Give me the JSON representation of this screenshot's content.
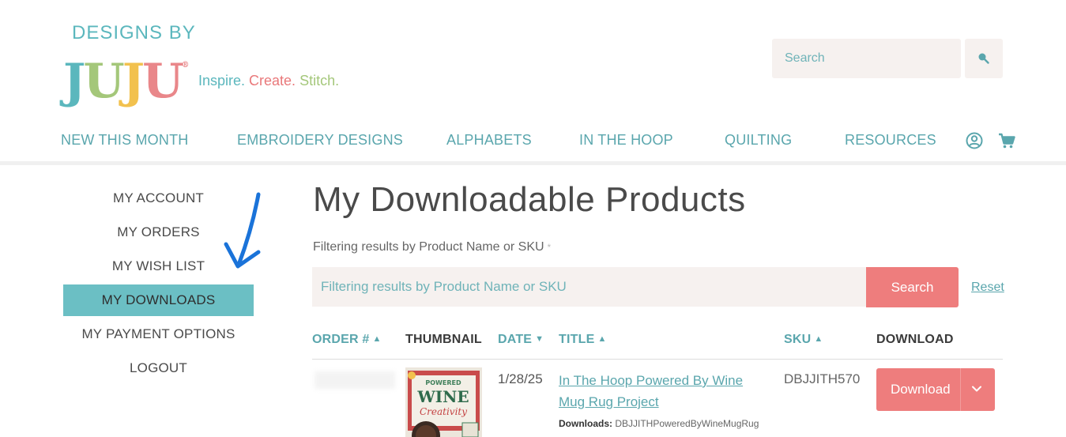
{
  "brand": {
    "logo_top": "DESIGNS BY",
    "logo_letters": [
      "J",
      "U",
      "J",
      "U"
    ],
    "logo_colors": [
      "#5bb7bd",
      "#a4c77a",
      "#f2c14e",
      "#e9878a"
    ],
    "registered": "®",
    "tagline_parts": [
      "Inspire.",
      " Create.",
      " Stitch."
    ],
    "tagline_colors": [
      "#5bb7bd",
      "#e9787a",
      "#a4c77a"
    ]
  },
  "header": {
    "search_placeholder": "Search",
    "search_icon": "search-icon"
  },
  "nav": {
    "items": [
      "NEW THIS MONTH",
      "EMBROIDERY DESIGNS",
      "ALPHABETS",
      "IN THE HOOP",
      "QUILTING",
      "RESOURCES"
    ],
    "account_icon": "user-circle-icon",
    "cart_icon": "cart-icon"
  },
  "sidebar": {
    "items": [
      "MY ACCOUNT",
      "MY ORDERS",
      "MY WISH LIST",
      "MY DOWNLOADS",
      "MY PAYMENT OPTIONS",
      "LOGOUT"
    ],
    "active_index": 3,
    "active_color": "#6bbfc4"
  },
  "annotation": {
    "arrow_icon": "blue-arrow-pointer",
    "arrow_color": "#1a73d9"
  },
  "main": {
    "title": "My Downloadable Products",
    "filter_label": "Filtering results by Product Name or SKU",
    "filter_required_mark": "*",
    "filter_placeholder": "Filtering results by Product Name or SKU",
    "search_button": "Search",
    "reset_link": "Reset",
    "accent_color": "#ee7d7d"
  },
  "table": {
    "headers": {
      "order": "ORDER #",
      "thumbnail": "THUMBNAIL",
      "date": "DATE",
      "title": "TITLE",
      "sku": "SKU",
      "download": "DOWNLOAD"
    },
    "carets": {
      "up": "▲",
      "down": "▼"
    },
    "rows": [
      {
        "order": "",
        "thumbnail_words": [
          "POWERED",
          "WINE",
          "Creativity"
        ],
        "date": "1/28/25",
        "title": "In The Hoop Powered By Wine Mug Rug Project",
        "downloads_label": "Downloads:",
        "downloads_value": " DBJJITHPoweredByWineMugRug",
        "sku": "DBJJITH570",
        "download_button": "Download"
      }
    ]
  }
}
